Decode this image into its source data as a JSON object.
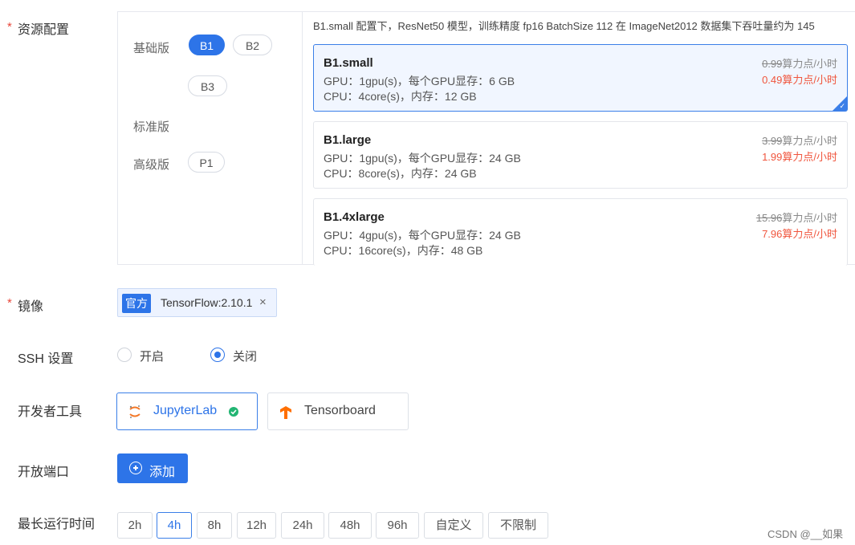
{
  "form": {
    "resource_label": "资源配置",
    "image_label": "镜像",
    "ssh_label": "SSH 设置",
    "devtools_label": "开发者工具",
    "ports_label": "开放端口",
    "runtime_label": "最长运行时间",
    "required_mark": "*"
  },
  "tiers": {
    "basic": "基础版",
    "standard": "标准版",
    "advanced": "高级版",
    "options": [
      "B1",
      "B2",
      "B3",
      "P1"
    ],
    "selected": "B1"
  },
  "description": "B1.small 配置下，ResNet50 模型，训练精度 fp16 BatchSize 112 在 ImageNet2012 数据集下吞吐量约为 145",
  "instances": [
    {
      "name": "B1.small",
      "gpu": "GPU：1gpu(s)，每个GPU显存：6 GB",
      "cpu": "CPU：4core(s)，内存：12 GB",
      "old_price": "0.99",
      "old_unit": "算力点/小时",
      "new_price": "0.49算力点/小时",
      "selected": true
    },
    {
      "name": "B1.large",
      "gpu": "GPU：1gpu(s)，每个GPU显存：24 GB",
      "cpu": "CPU：8core(s)，内存：24 GB",
      "old_price": "3.99",
      "old_unit": "算力点/小时",
      "new_price": "1.99算力点/小时",
      "selected": false
    },
    {
      "name": "B1.4xlarge",
      "gpu": "GPU：4gpu(s)，每个GPU显存：24 GB",
      "cpu": "CPU：16core(s)，内存：48 GB",
      "old_price": "15.96",
      "old_unit": "算力点/小时",
      "new_price": "7.96算力点/小时",
      "selected": false
    }
  ],
  "image": {
    "badge": "官方",
    "name": "TensorFlow:2.10.1",
    "close": "×"
  },
  "ssh": {
    "on": "开启",
    "off": "关闭",
    "selected": "关闭"
  },
  "tools": [
    {
      "name": "JupyterLab",
      "selected": true,
      "icon": "jupyter-icon"
    },
    {
      "name": "Tensorboard",
      "selected": false,
      "icon": "tensorboard-icon"
    }
  ],
  "ports": {
    "add_label": "添加"
  },
  "durations": {
    "options": [
      "2h",
      "4h",
      "8h",
      "12h",
      "24h",
      "48h",
      "96h",
      "自定义",
      "不限制"
    ],
    "selected": "4h"
  },
  "watermark": "CSDN @__如果",
  "colors": {
    "primary": "#2d74e8",
    "price": "#f0553d",
    "success": "#22b573",
    "required": "#e8473a"
  }
}
